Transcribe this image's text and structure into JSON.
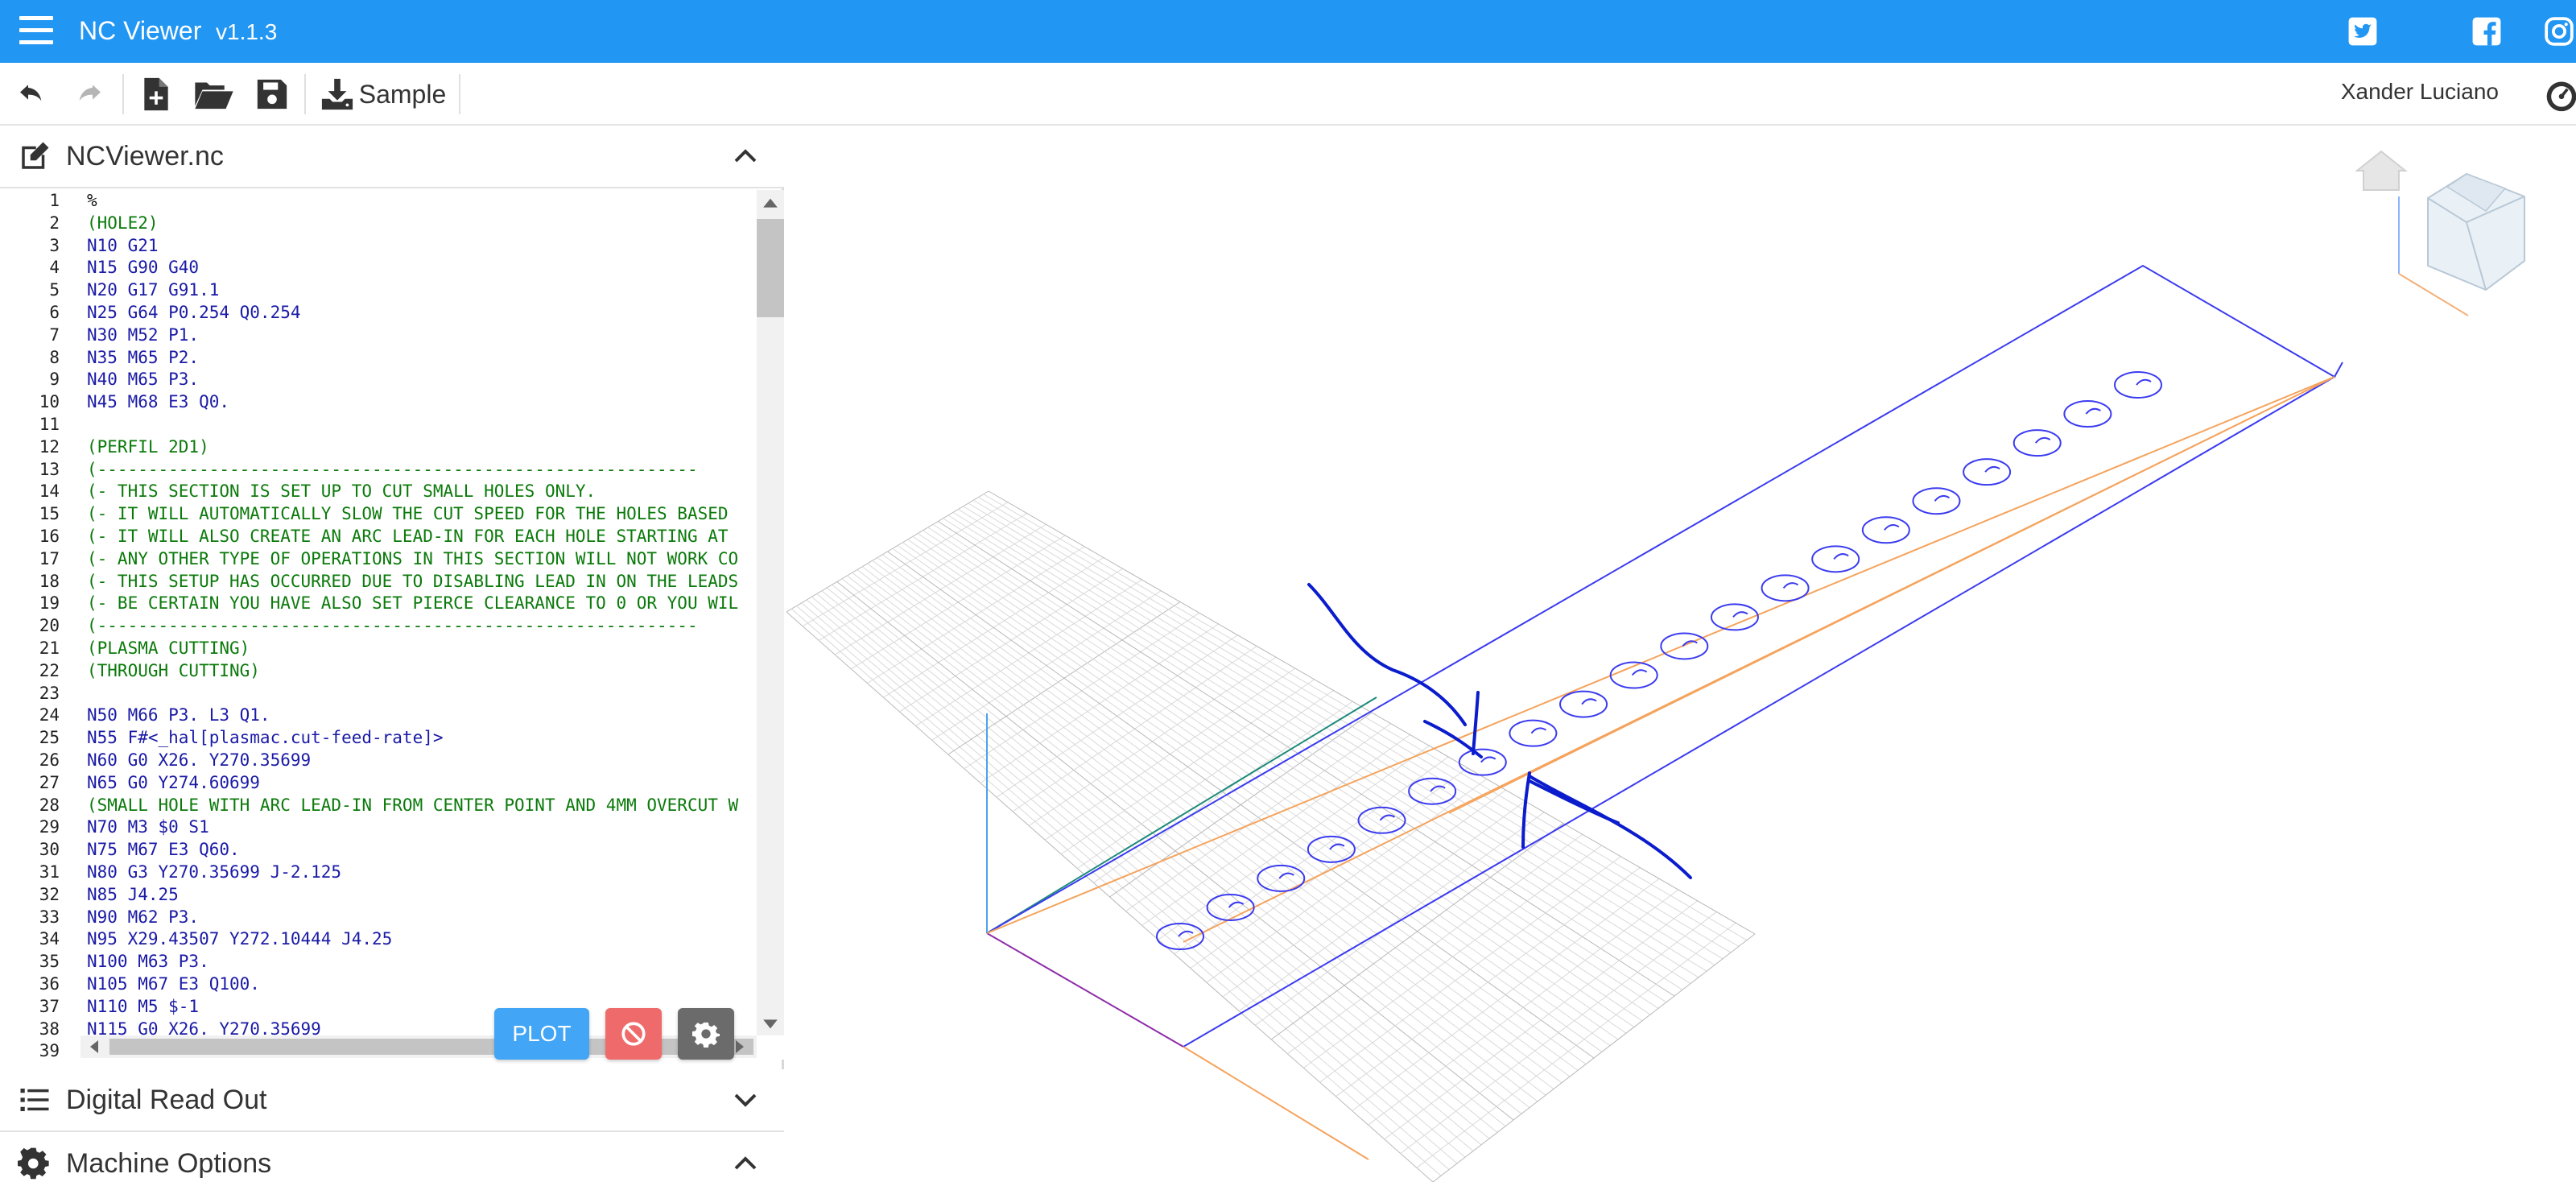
{
  "app": {
    "title": "NC Viewer",
    "version": "v1.1.3",
    "brand_color": "#2196f3"
  },
  "social": {
    "twitter": "twitter-icon",
    "facebook": "facebook-icon",
    "instagram": "instagram-icon"
  },
  "toolbar": {
    "undo": "undo-icon",
    "redo": "redo-icon",
    "new_file": "new-file-icon",
    "open": "folder-open-icon",
    "save": "save-icon",
    "sample_label": "Sample"
  },
  "user": {
    "name": "Xander Luciano"
  },
  "file_panel": {
    "title": "NCViewer.nc"
  },
  "editor": {
    "lines": [
      {
        "n": "1",
        "text": "%"
      },
      {
        "n": "2",
        "text": "(HOLE2)"
      },
      {
        "n": "3",
        "text": "N10 G21"
      },
      {
        "n": "4",
        "text": "N15 G90 G40"
      },
      {
        "n": "5",
        "text": "N20 G17 G91.1"
      },
      {
        "n": "6",
        "text": "N25 G64 P0.254 Q0.254"
      },
      {
        "n": "7",
        "text": "N30 M52 P1."
      },
      {
        "n": "8",
        "text": "N35 M65 P2."
      },
      {
        "n": "9",
        "text": "N40 M65 P3."
      },
      {
        "n": "10",
        "text": "N45 M68 E3 Q0."
      },
      {
        "n": "11",
        "text": ""
      },
      {
        "n": "12",
        "text": "(PERFIL 2D1)"
      },
      {
        "n": "13",
        "text": "(-----------------------------------------------------------"
      },
      {
        "n": "14",
        "text": "(- THIS SECTION IS SET UP TO CUT SMALL HOLES ONLY."
      },
      {
        "n": "15",
        "text": "(- IT WILL AUTOMATICALLY SLOW THE CUT SPEED FOR THE HOLES BASED"
      },
      {
        "n": "16",
        "text": "(- IT WILL ALSO CREATE AN ARC LEAD-IN FOR EACH HOLE STARTING AT"
      },
      {
        "n": "17",
        "text": "(- ANY OTHER TYPE OF OPERATIONS IN THIS SECTION WILL NOT WORK CO"
      },
      {
        "n": "18",
        "text": "(- THIS SETUP HAS OCCURRED DUE TO DISABLING LEAD IN ON THE LEADS"
      },
      {
        "n": "19",
        "text": "(- BE CERTAIN YOU HAVE ALSO SET PIERCE CLEARANCE TO 0 OR YOU WIL"
      },
      {
        "n": "20",
        "text": "(-----------------------------------------------------------"
      },
      {
        "n": "21",
        "text": "(PLASMA CUTTING)"
      },
      {
        "n": "22",
        "text": "(THROUGH CUTTING)"
      },
      {
        "n": "23",
        "text": ""
      },
      {
        "n": "24",
        "text": "N50 M66 P3. L3 Q1."
      },
      {
        "n": "25",
        "text": "N55 F#<_hal[plasmac.cut-feed-rate]>"
      },
      {
        "n": "26",
        "text": "N60 G0 X26. Y270.35699"
      },
      {
        "n": "27",
        "text": "N65 G0 Y274.60699"
      },
      {
        "n": "28",
        "text": "(SMALL HOLE WITH ARC LEAD-IN FROM CENTER POINT AND 4MM OVERCUT W"
      },
      {
        "n": "29",
        "text": "N70 M3 $0 S1"
      },
      {
        "n": "30",
        "text": "N75 M67 E3 Q60."
      },
      {
        "n": "31",
        "text": "N80 G3 Y270.35699 J-2.125"
      },
      {
        "n": "32",
        "text": "N85 J4.25"
      },
      {
        "n": "33",
        "text": "N90 M62 P3."
      },
      {
        "n": "34",
        "text": "N95 X29.43507 Y272.10444 J4.25"
      },
      {
        "n": "35",
        "text": "N100 M63 P3."
      },
      {
        "n": "36",
        "text": "N105 M67 E3 Q100."
      },
      {
        "n": "37",
        "text": "N110 M5 $-1"
      },
      {
        "n": "38",
        "text": "N115 G0 X26. Y270.35699"
      },
      {
        "n": "39",
        "text": ""
      }
    ]
  },
  "actions": {
    "plot_label": "PLOT",
    "stop_icon": "stop-icon",
    "settings_icon": "gear-icon"
  },
  "dro_panel": {
    "title": "Digital Read Out"
  },
  "machine_panel": {
    "title": "Machine Options"
  },
  "viewport": {
    "home_icon": "home-icon",
    "view_cube": "view-cube-icon",
    "hole_count": 20
  }
}
